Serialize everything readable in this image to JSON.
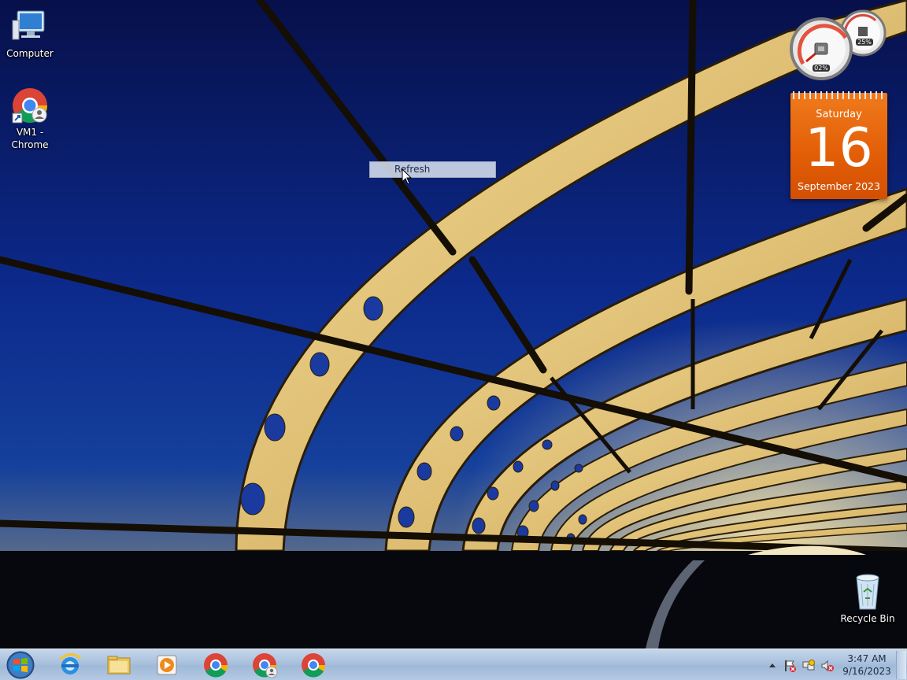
{
  "desktop": {
    "icons": [
      {
        "label": "Computer",
        "icon": "computer-icon"
      },
      {
        "label": "VM1 -\nChrome",
        "icon": "chrome-shortcut-icon"
      },
      {
        "label": "Recycle Bin",
        "icon": "recycle-bin-icon"
      }
    ]
  },
  "gadgets": {
    "cpu_meter": {
      "cpu_percent": "02%",
      "memory_percent": "25%"
    },
    "calendar": {
      "weekday": "Saturday",
      "day": "16",
      "month_year": "September 2023"
    }
  },
  "context_menu": {
    "items": [
      {
        "label": "Refresh"
      }
    ]
  },
  "taskbar": {
    "pinned": [
      {
        "name": "internet-explorer",
        "icon": "internet-explorer-icon"
      },
      {
        "name": "windows-explorer",
        "icon": "folder-icon"
      },
      {
        "name": "media-player",
        "icon": "media-player-icon"
      },
      {
        "name": "chrome",
        "icon": "chrome-icon"
      },
      {
        "name": "chrome-profile",
        "icon": "chrome-profile-icon"
      },
      {
        "name": "chrome-2",
        "icon": "chrome-icon"
      }
    ],
    "clock": {
      "time": "3:47 AM",
      "date": "9/16/2023"
    }
  },
  "colors": {
    "calendar_orange": "#e8650c",
    "taskbar": "#b1c7e1",
    "sky": "#0b1a6b"
  }
}
